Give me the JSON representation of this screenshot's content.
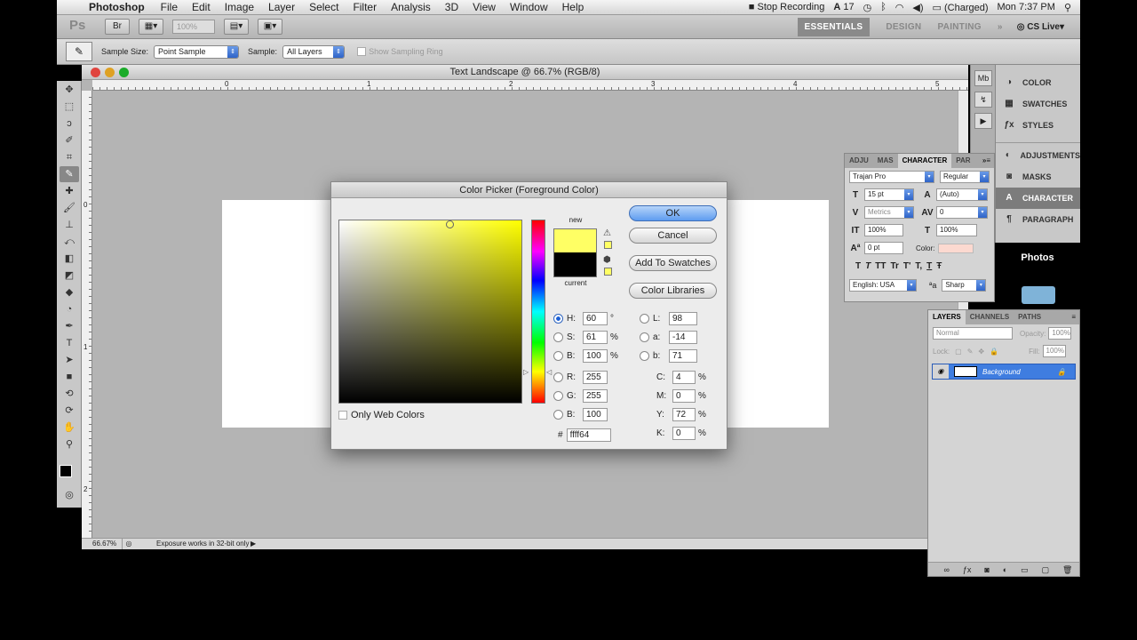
{
  "menubar": {
    "app_name": "Photoshop",
    "items": [
      "File",
      "Edit",
      "Image",
      "Layer",
      "Select",
      "Filter",
      "Analysis",
      "3D",
      "View",
      "Window",
      "Help"
    ],
    "stop_recording": "Stop Recording",
    "adobe_count": "17",
    "battery": "(Charged)",
    "clock": "Mon 7:37 PM"
  },
  "appbar": {
    "logo": "Ps",
    "zoom": "100%",
    "workspaces": [
      "ESSENTIALS",
      "DESIGN",
      "PAINTING"
    ],
    "more": "»",
    "cs_live": "CS Live"
  },
  "options": {
    "sample_size_label": "Sample Size:",
    "sample_size_value": "Point Sample",
    "sample_label": "Sample:",
    "sample_value": "All Layers",
    "show_ring": "Show Sampling Ring"
  },
  "document": {
    "title": "Text Landscape @ 66.7% (RGB/8)",
    "ruler_numbers": [
      "0",
      "1",
      "2",
      "3",
      "4",
      "5"
    ],
    "ruler_left_numbers": [
      "0",
      "1",
      "2"
    ],
    "zoom": "66.67%",
    "status": "Exposure works in 32-bit only"
  },
  "panelstack": {
    "group1": [
      "COLOR",
      "SWATCHES",
      "STYLES"
    ],
    "group2": [
      "ADJUSTMENTS",
      "MASKS",
      "CHARACTER",
      "PARAGRAPH"
    ]
  },
  "desktop": {
    "photos": "Photos"
  },
  "character": {
    "tabs": [
      "ADJU",
      "MAS",
      "CHARACTER",
      "PAR"
    ],
    "font": "Trajan Pro",
    "style": "Regular",
    "size": "15 pt",
    "leading": "(Auto)",
    "kerning": "Metrics",
    "tracking": "0",
    "vscale": "100%",
    "hscale": "100%",
    "baseline": "0 pt",
    "color_label": "Color:",
    "style_buttons": [
      "T",
      "T",
      "TT",
      "Tr",
      "T'",
      "T,",
      "T",
      "Ŧ"
    ],
    "language": "English: USA",
    "aa_label": "ªa",
    "aa": "Sharp"
  },
  "layers": {
    "tabs": [
      "LAYERS",
      "CHANNELS",
      "PATHS"
    ],
    "blend": "Normal",
    "opacity_label": "Opacity:",
    "opacity": "100%",
    "lock_label": "Lock:",
    "fill_label": "Fill:",
    "fill": "100%",
    "layer_name": "Background"
  },
  "picker": {
    "title": "Color Picker (Foreground Color)",
    "new_label": "new",
    "current_label": "current",
    "ok": "OK",
    "cancel": "Cancel",
    "add_swatches": "Add To Swatches",
    "libraries": "Color Libraries",
    "only_web": "Only Web Colors",
    "hsb": [
      {
        "label": "H:",
        "value": "60",
        "unit": "°"
      },
      {
        "label": "S:",
        "value": "61",
        "unit": "%"
      },
      {
        "label": "B:",
        "value": "100",
        "unit": "%"
      }
    ],
    "rgb": [
      {
        "label": "R:",
        "value": "255"
      },
      {
        "label": "G:",
        "value": "255"
      },
      {
        "label": "B:",
        "value": "100"
      }
    ],
    "lab": [
      {
        "label": "L:",
        "value": "98"
      },
      {
        "label": "a:",
        "value": "-14"
      },
      {
        "label": "b:",
        "value": "71"
      }
    ],
    "cmyk": [
      {
        "label": "C:",
        "value": "4",
        "unit": "%"
      },
      {
        "label": "M:",
        "value": "0",
        "unit": "%"
      },
      {
        "label": "Y:",
        "value": "72",
        "unit": "%"
      },
      {
        "label": "K:",
        "value": "0",
        "unit": "%"
      }
    ],
    "hex_label": "#",
    "hex": "ffff64",
    "new_color": "#ffff64",
    "current_color": "#000000"
  }
}
